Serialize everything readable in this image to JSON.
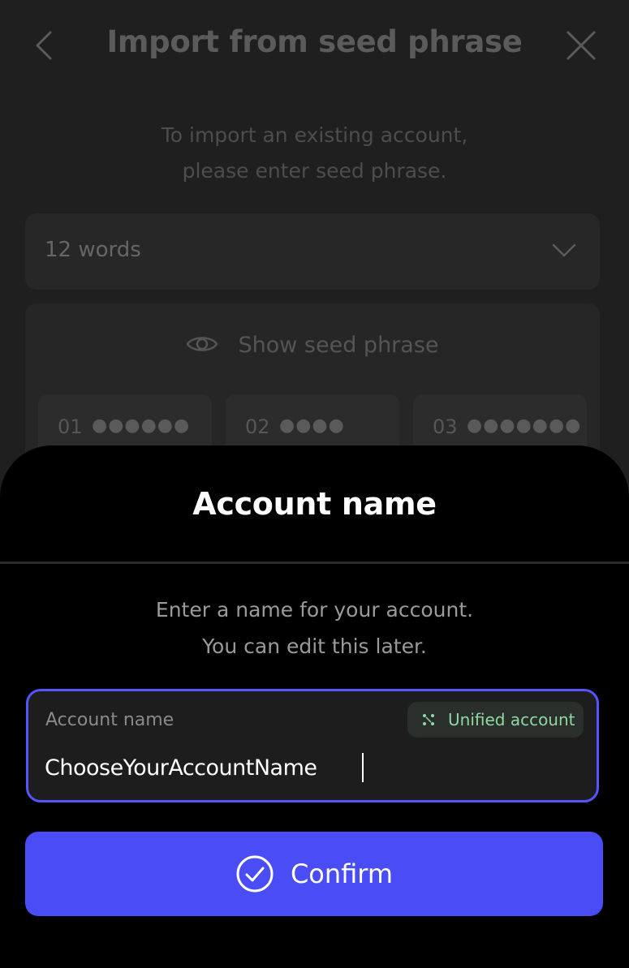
{
  "background_screen": {
    "title": "Import from seed phrase",
    "subtitle_line1": "To import an existing account,",
    "subtitle_line2": "please enter seed phrase.",
    "word_count_select": {
      "value": "12 words",
      "icon": "chevron-down-icon"
    },
    "show_seed_label": "Show seed phrase",
    "seed_words": [
      {
        "num": "01",
        "masked": "●●●●●●"
      },
      {
        "num": "02",
        "masked": "●●●●"
      },
      {
        "num": "03",
        "masked": "●●●●●●●"
      }
    ]
  },
  "sheet": {
    "title": "Account name",
    "desc_line1": "Enter a name for your account.",
    "desc_line2": "You can edit this later.",
    "field": {
      "label": "Account name",
      "value": "ChooseYourAccountName",
      "badge": "Unified account"
    },
    "confirm_label": "Confirm"
  },
  "colors": {
    "accent": "#4a4df5",
    "field_border": "#5555ff",
    "badge_text": "#8fd8a4",
    "sheet_bg": "#000000",
    "screen_bg": "#1f1f1f"
  }
}
